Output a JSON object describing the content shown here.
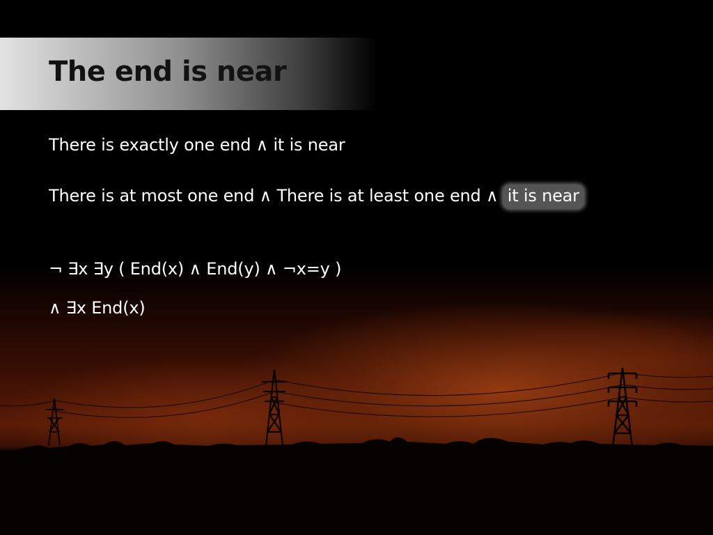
{
  "slide": {
    "title": "The end is near",
    "line1": "There is exactly one end ∧ it is near",
    "line2_main": "There is at most one end ∧ There is at least one end ∧ ",
    "line2_highlight": "it is near",
    "formula1": "¬ ∃x ∃y ( End(x) ∧ End(y) ∧ ¬x=y )",
    "formula2": "∧ ∃x End(x)"
  },
  "colors": {
    "background": "#000000",
    "text": "#ffffff",
    "title_text": "#121212",
    "sunset": "#5a1b06",
    "highlight": "#555555"
  },
  "icons": [
    "power-pylon-silhouette",
    "tree-line-silhouette"
  ]
}
